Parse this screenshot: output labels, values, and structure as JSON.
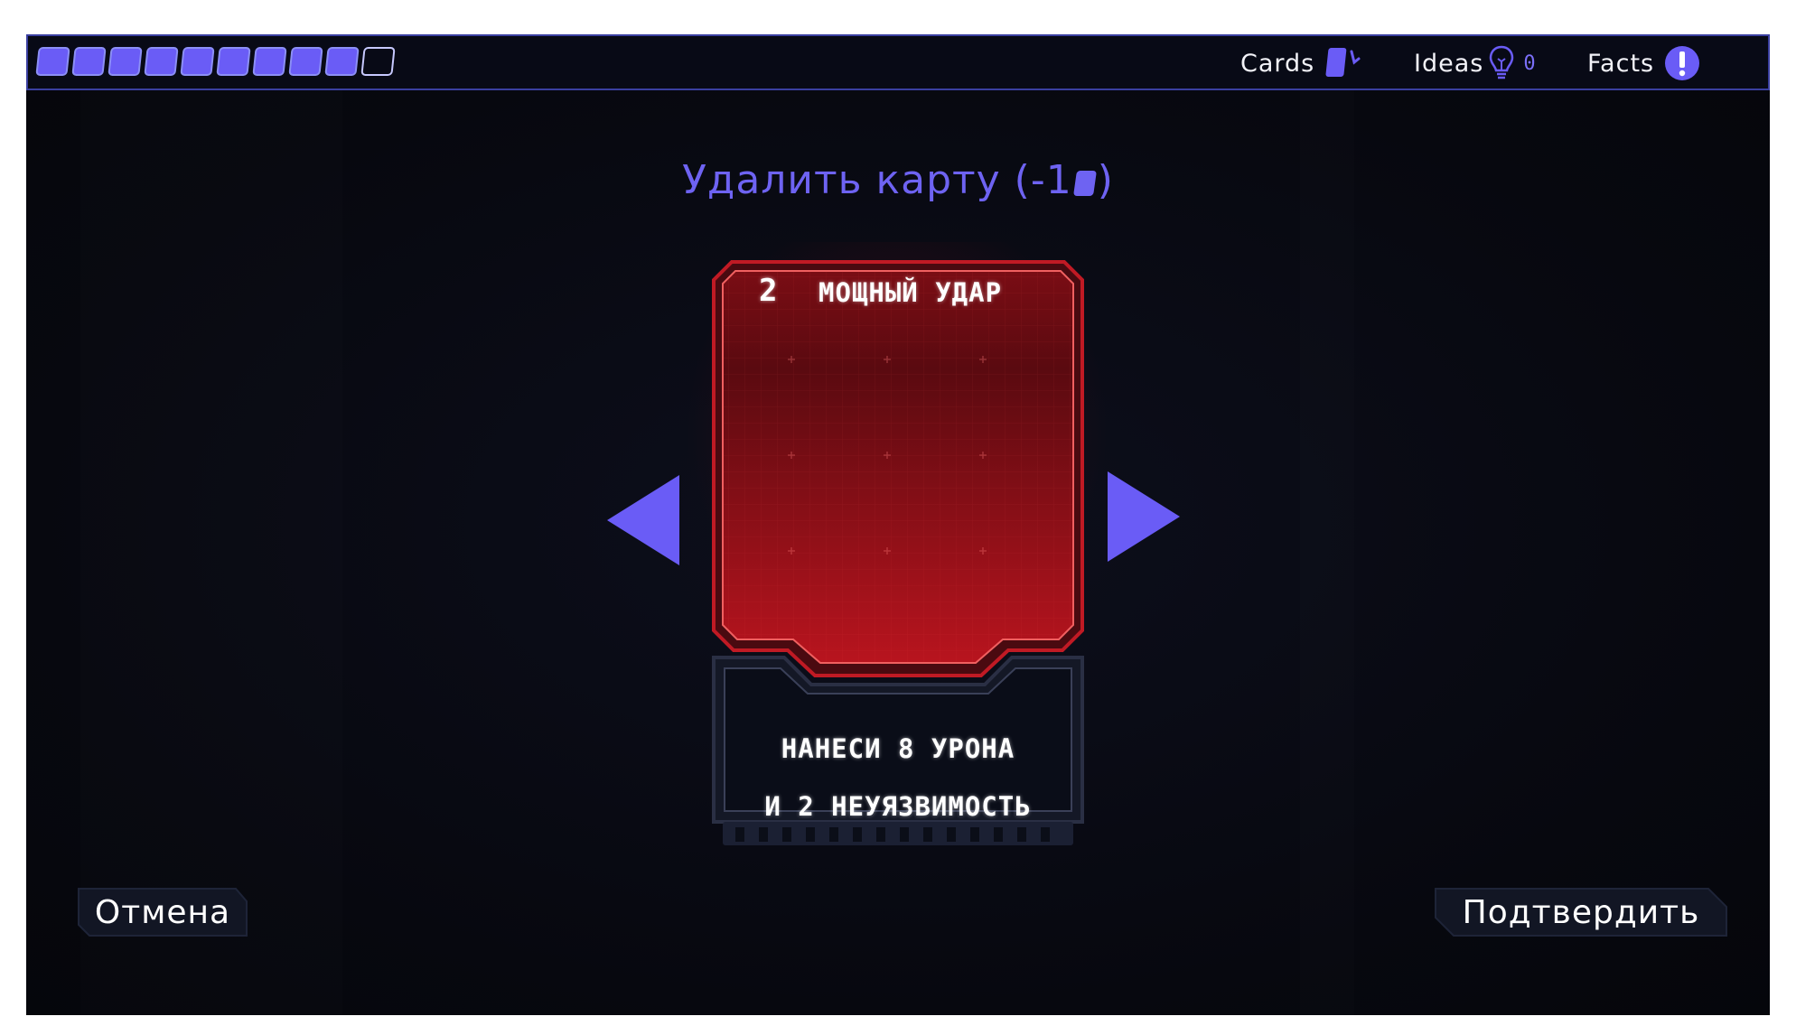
{
  "energy": {
    "filled": 9,
    "total": 10,
    "color": "#6a5cf6"
  },
  "topbar": {
    "cards_label": "Cards",
    "ideas_label": "Ideas",
    "ideas_count": "0",
    "facts_label": "Facts"
  },
  "title": {
    "prefix": "Удалить карту (-1",
    "suffix": ")"
  },
  "card": {
    "cost": "2",
    "name": "МОЩНЫЙ УДАР",
    "description_line1": "НАНЕСИ 8 УРОНА",
    "description_line2": "И 2 НЕУЯЗВИМОСТЬ",
    "color": "#b8141e"
  },
  "buttons": {
    "cancel": "Отмена",
    "confirm": "Подтвердить"
  },
  "accent_color": "#6a5cf6"
}
